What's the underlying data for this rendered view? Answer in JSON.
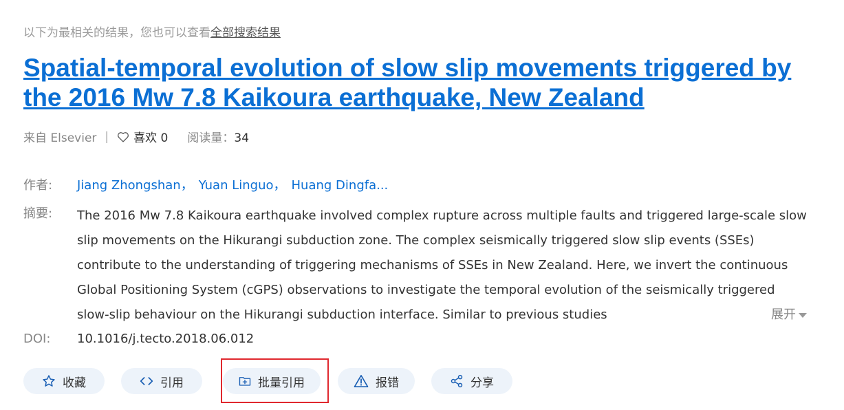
{
  "hint": {
    "prefix": "以下为最相关的结果，您也可以查看",
    "link": "全部搜索结果"
  },
  "title": "Spatial-temporal evolution of slow slip movements triggered by the 2016 Mw 7.8 Kaikoura earthquake, New Zealand",
  "meta": {
    "source": "来自 Elsevier",
    "separator": "|",
    "like_label": "喜欢 0",
    "reads_label": "阅读量：",
    "reads_value": "34"
  },
  "authors": {
    "label": "作者:",
    "names": [
      "Jiang Zhongshan，",
      "Yuan Linguo，",
      "Huang Dingfa..."
    ]
  },
  "abstract": {
    "label": "摘要:",
    "text": "The 2016 Mw 7.8 Kaikoura earthquake involved complex rupture across multiple faults and triggered large-scale slow slip movements on the Hikurangi subduction zone. The complex seismically triggered slow slip events (SSEs) contribute to the understanding of triggering mechanisms of SSEs in New Zealand. Here, we invert the continuous Global Positioning System (cGPS) observations to investigate the temporal evolution of the seismically triggered slow-slip behaviour on the Hikurangi subduction interface. Similar to previous studies",
    "expand_label": "展开"
  },
  "doi": {
    "label": "DOI:",
    "value": "10.1016/j.tecto.2018.06.012"
  },
  "actions": [
    {
      "label": "收藏",
      "icon": "star-icon"
    },
    {
      "label": "引用",
      "icon": "code-icon"
    },
    {
      "label": "批量引用",
      "icon": "folder-plus-icon"
    },
    {
      "label": "报错",
      "icon": "warning-icon"
    },
    {
      "label": "分享",
      "icon": "share-icon"
    }
  ],
  "colors": {
    "link": "#0b6fd4",
    "button_bg": "#edf3fa",
    "highlight": "#e0282e"
  }
}
